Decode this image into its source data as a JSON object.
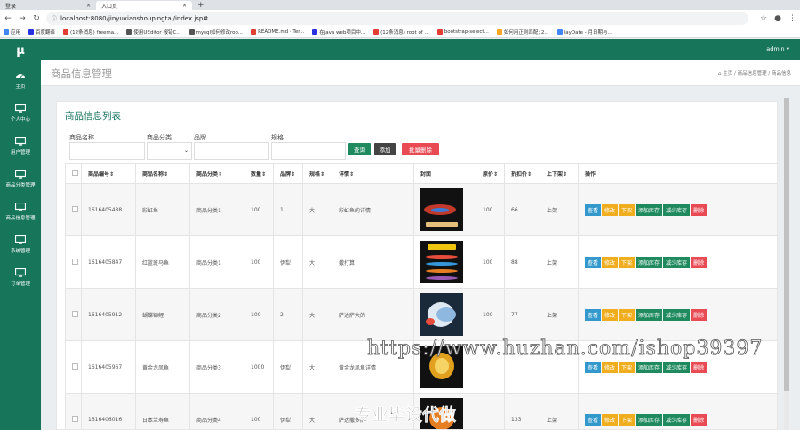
{
  "browser": {
    "tabs": [
      {
        "label": "登录",
        "active": false
      },
      {
        "label": "入口页",
        "active": true
      }
    ],
    "url": "localhost:8080/jinyuxiaoshoupingtai/index.jsp#",
    "bookmarks": [
      "应用",
      "百度翻译",
      "(12条消息) freema...",
      "使用UEditor 报错C...",
      "mysql如何修改roo...",
      "README.md · Ter...",
      "在java web项目中...",
      "(12条消息) root of ...",
      "bootstrap-select...",
      "如何用正则匹配; 2...",
      "layDate - 月日期与..."
    ]
  },
  "sidebar": {
    "logo": "μ",
    "items": [
      {
        "label": "主页",
        "icon": "dashboard-icon"
      },
      {
        "label": "个人中心",
        "icon": "monitor-icon"
      },
      {
        "label": "用户管理",
        "icon": "monitor-icon"
      },
      {
        "label": "商品分类管理",
        "icon": "monitor-icon"
      },
      {
        "label": "商品信息管理",
        "icon": "monitor-icon"
      },
      {
        "label": "系统管理",
        "icon": "monitor-icon"
      },
      {
        "label": "订单管理",
        "icon": "monitor-icon"
      }
    ]
  },
  "header": {
    "user": "admin ▾",
    "page_title": "商品信息管理",
    "breadcrumb": "⌂ 主页 / 商品信息管理 / 商品信息"
  },
  "panel": {
    "title": "商品信息列表",
    "filters": {
      "name_label": "商品名称",
      "category_label": "商品分类",
      "brand_label": "品牌",
      "spec_label": "规格"
    },
    "buttons": {
      "query": "查询",
      "add": "添加",
      "batch_delete": "批量删除"
    },
    "columns": [
      "商品编号⇕",
      "商品名称⇕",
      "商品分类⇕",
      "数量⇕",
      "品牌⇕",
      "规格⇕",
      "详情⇕",
      "封面",
      "原价⇕",
      "折扣价⇕",
      "上下架⇕",
      "操作"
    ],
    "rows": [
      {
        "id": "1616405488",
        "name": "彩虹鱼",
        "category": "商品分类1",
        "qty": "100",
        "brand": "1",
        "spec": "大",
        "detail": "彩虹鱼的详情",
        "price": "100",
        "discount": "66",
        "status": "上架"
      },
      {
        "id": "1616405847",
        "name": "红蓝斑马鱼",
        "category": "商品分类1",
        "qty": "100",
        "brand": "伊犁",
        "spec": "大",
        "detail": "撒打算",
        "price": "100",
        "discount": "88",
        "status": "上架"
      },
      {
        "id": "1616405912",
        "name": "蝴蝶锦鲤",
        "category": "商品分类2",
        "qty": "100",
        "brand": "2",
        "spec": "大",
        "detail": "萨达萨大的",
        "price": "100",
        "discount": "77",
        "status": "上架"
      },
      {
        "id": "1616405967",
        "name": "黄金龙凤鱼",
        "category": "商品分类3",
        "qty": "1000",
        "brand": "伊犁",
        "spec": "大",
        "detail": "黄金龙凤鱼详情",
        "price": "",
        "discount": "",
        "status": ""
      },
      {
        "id": "1616406016",
        "name": "日本兰寿鱼",
        "category": "商品分类4",
        "qty": "100",
        "brand": "伊犁",
        "spec": "大",
        "detail": "萨达撒多萨",
        "price": "",
        "discount": "133",
        "status": "上架"
      }
    ],
    "row_actions": {
      "view": "查看",
      "edit": "修改",
      "unlist": "下架",
      "add_stock": "添加库存",
      "reduce_stock": "减少库存",
      "delete": "删除"
    }
  },
  "overlay": {
    "watermark": "https://www.huzhan.com/ishop39397",
    "caption": "专业毕设代做"
  },
  "colors": {
    "brand": "#17755a",
    "query": "#1e8a5e",
    "danger": "#e94b55",
    "warning": "#f0ad1e",
    "info": "#3399cc"
  }
}
